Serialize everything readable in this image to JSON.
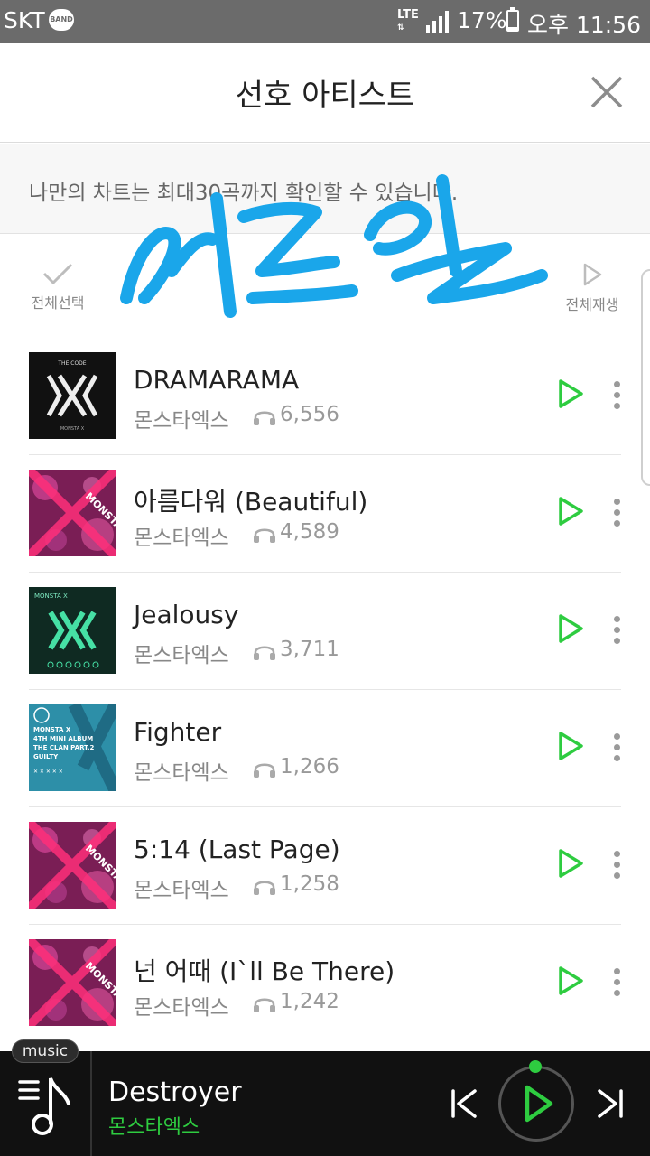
{
  "status_bar": {
    "carrier": "SKT",
    "band_badge": "BAND",
    "network": "LTE",
    "battery": "17%",
    "time": "오후 11:56",
    "battery_level": 0.17
  },
  "header": {
    "title": "선호 아티스트"
  },
  "notice": "나만의 차트는 최대30곡까지 확인할 수 있습니다.",
  "toolbar": {
    "select_all": "전체선택",
    "play_all": "전체재생"
  },
  "watermark": "에드윌",
  "songs": [
    {
      "title": "DRAMARAMA",
      "artist": "몬스타엑스",
      "plays": "6,556",
      "cover": "the-code"
    },
    {
      "title": "아름다워 (Beautiful)",
      "artist": "몬스타엑스",
      "plays": "4,589",
      "cover": "beautiful"
    },
    {
      "title": "Jealousy",
      "artist": "몬스타엑스",
      "plays": "3,711",
      "cover": "jealousy"
    },
    {
      "title": "Fighter",
      "artist": "몬스타엑스",
      "plays": "1,266",
      "cover": "guilty"
    },
    {
      "title": "5:14 (Last Page)",
      "artist": "몬스타엑스",
      "plays": "1,258",
      "cover": "beautiful"
    },
    {
      "title": "넌 어때 (I`ll Be There)",
      "artist": "몬스타엑스",
      "plays": "1,242",
      "cover": "beautiful"
    }
  ],
  "covers": {
    "the_code_label": "THE CODE",
    "the_code_sub": "MONSTA X",
    "beautiful_label": "MONSTA",
    "jealousy_label": "MONSTA X",
    "guilty_lines": [
      "MONSTA X",
      "4TH MINI ALBUM",
      "THE CLAN PART.2",
      "GUILTY"
    ]
  },
  "player": {
    "tab": "music",
    "title": "Destroyer",
    "artist": "몬스타엑스"
  },
  "colors": {
    "accent_green": "#2ecc40",
    "watermark_blue": "#1aa6ea",
    "status_bar": "#6b6b6b",
    "player_bg": "#111111"
  }
}
